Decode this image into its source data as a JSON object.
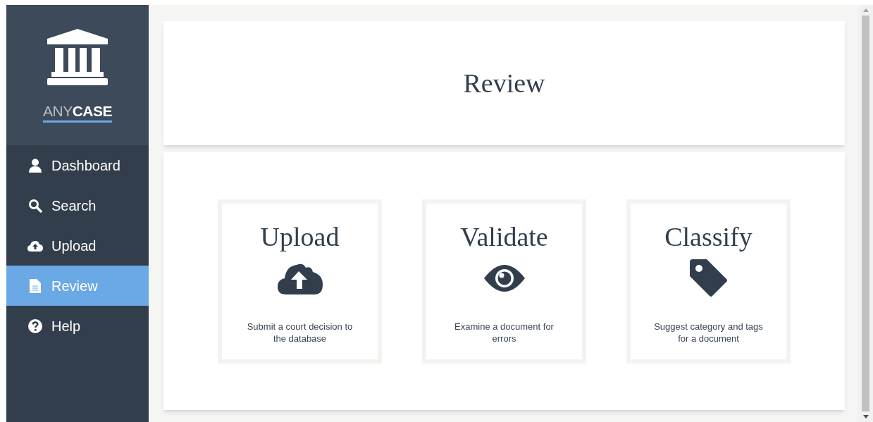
{
  "sidebar": {
    "brand": "ANY**CASE**",
    "items": [
      {
        "label": "Dashboard",
        "selected": false
      },
      {
        "label": "Search",
        "selected": false
      },
      {
        "label": "Upload",
        "selected": false
      },
      {
        "label": "Review",
        "selected": true
      },
      {
        "label": "Help",
        "selected": false
      }
    ]
  },
  "header": {
    "title": "Review"
  },
  "tiles": [
    {
      "title": "Upload",
      "description": "Submit a court decision to the database"
    },
    {
      "title": "Validate",
      "description": "Examine a document for errors"
    },
    {
      "title": "Classify",
      "description": "Suggest category and tags for a document"
    }
  ]
}
